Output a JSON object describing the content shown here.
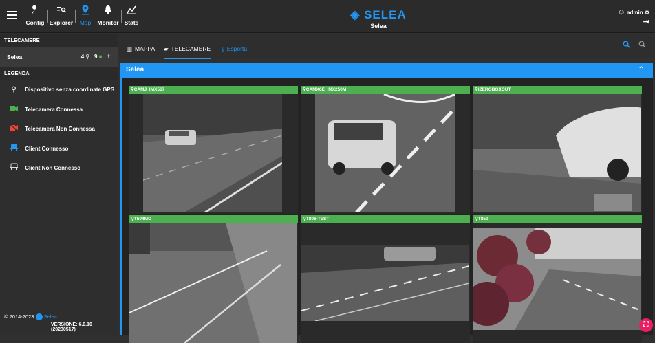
{
  "topbar": {
    "nav": [
      {
        "label": "Config",
        "icon": "wrench-icon",
        "glyph": "🔧"
      },
      {
        "label": "Explorer",
        "icon": "list-search-icon",
        "glyph": "☷"
      },
      {
        "label": "Map",
        "icon": "map-pin-icon",
        "glyph": "⚲"
      },
      {
        "label": "Monitor",
        "icon": "bell-icon",
        "glyph": "🔔"
      },
      {
        "label": "Stats",
        "icon": "chart-line-icon",
        "glyph": "⌇"
      }
    ],
    "logo": "SELEA",
    "logo_sub": "Selea",
    "user": "admin",
    "accent": "#2196f3"
  },
  "sidebar": {
    "cameras_heading": "TELECAMERE",
    "group_name": "Selea",
    "count_gps": "4",
    "count_cams": "9",
    "add_label": "+",
    "legend_heading": "LEGENDA",
    "legend": [
      {
        "label": "Dispositivo senza coordinate GPS",
        "icon": "no-gps-icon",
        "color": "#dddddd"
      },
      {
        "label": "Telecamera Connessa",
        "icon": "camera-connected-icon",
        "color": "#4caf50"
      },
      {
        "label": "Telecamera Non Connessa",
        "icon": "camera-disconnected-icon",
        "color": "#f44336"
      },
      {
        "label": "Client Connesso",
        "icon": "client-connected-icon",
        "color": "#2196f3"
      },
      {
        "label": "Client Non Connesso",
        "icon": "client-disconnected-icon",
        "color": "#dddddd"
      }
    ],
    "copyright": "© 2014-2023",
    "company": "Selea",
    "version": "VERSIONE: 6.0.10 (20230517)"
  },
  "tabs": [
    {
      "label": "MAPPA"
    },
    {
      "label": "TELECAMERE"
    },
    {
      "label": "Esporta"
    }
  ],
  "panel": {
    "title": "Selea"
  },
  "cameras": [
    {
      "name": "CAMJ_IMX567"
    },
    {
      "name": "CAMX6E_IMX250M"
    },
    {
      "name": "IZEROBOXOUT"
    },
    {
      "name": "T504MO"
    },
    {
      "name": "T806-TEST"
    },
    {
      "name": "T850"
    }
  ]
}
